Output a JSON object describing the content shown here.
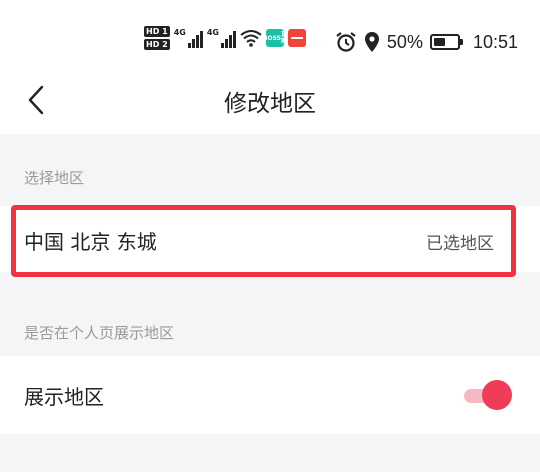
{
  "status_bar": {
    "hd1": "HD 1",
    "hd2": "HD 2",
    "net1": "4G",
    "net2": "4G",
    "boss_line1": "BOSS",
    "boss_line2": "直聘",
    "battery": "50%",
    "time": "10:51"
  },
  "header": {
    "title": "修改地区"
  },
  "region_section": {
    "label": "选择地区",
    "current_region": "中国 北京 东城",
    "hint": "已选地区"
  },
  "display_section": {
    "label": "是否在个人页展示地区",
    "toggle_label": "展示地区",
    "toggle_on": true
  },
  "colors": {
    "highlight": "#f0333f",
    "toggle_knob": "#f03c58",
    "toggle_track": "#f6b8c2"
  }
}
